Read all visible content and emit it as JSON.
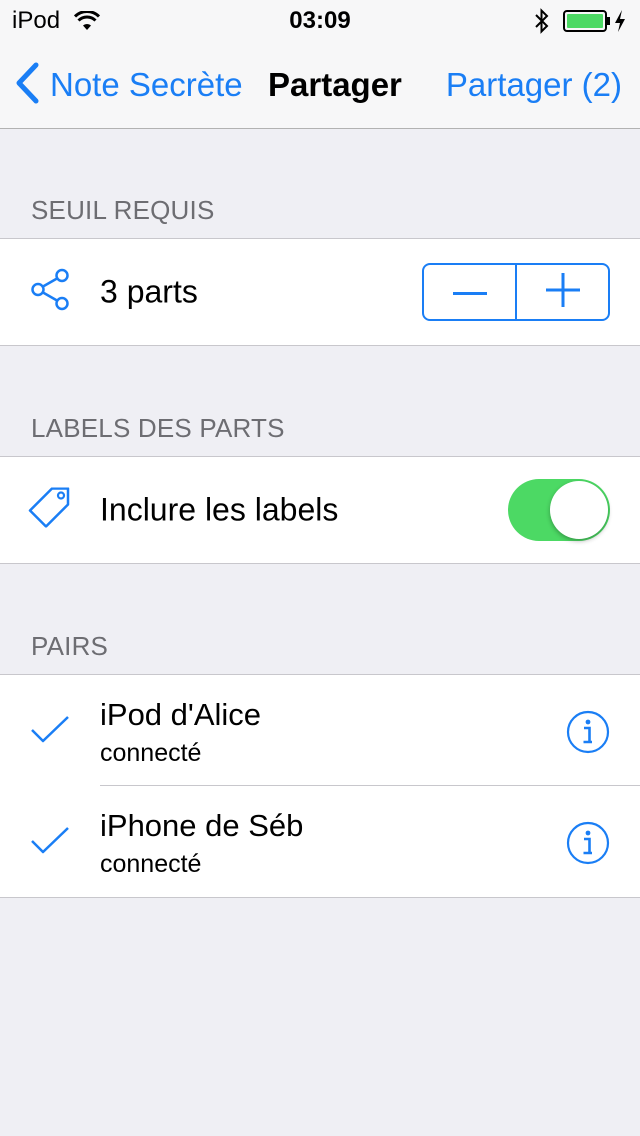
{
  "status_bar": {
    "carrier": "iPod",
    "time": "03:09"
  },
  "nav": {
    "back_label": "Note Secrète",
    "title": "Partager",
    "action_label": "Partager (2)"
  },
  "threshold": {
    "header": "SEUIL REQUIS",
    "icon": "share-icon",
    "value_label": "3 parts"
  },
  "labels": {
    "header": "LABELS DES PARTS",
    "icon": "tag-icon",
    "toggle_label": "Inclure les labels",
    "toggle_on": true
  },
  "peers": {
    "header": "PAIRS",
    "items": [
      {
        "name": "iPod d'Alice",
        "status": "connecté"
      },
      {
        "name": "iPhone de Séb",
        "status": "connecté"
      }
    ]
  },
  "colors": {
    "accent": "#1a7ef5",
    "toggle_on": "#4cd964",
    "background": "#efeff4",
    "battery": "#4cd964"
  }
}
